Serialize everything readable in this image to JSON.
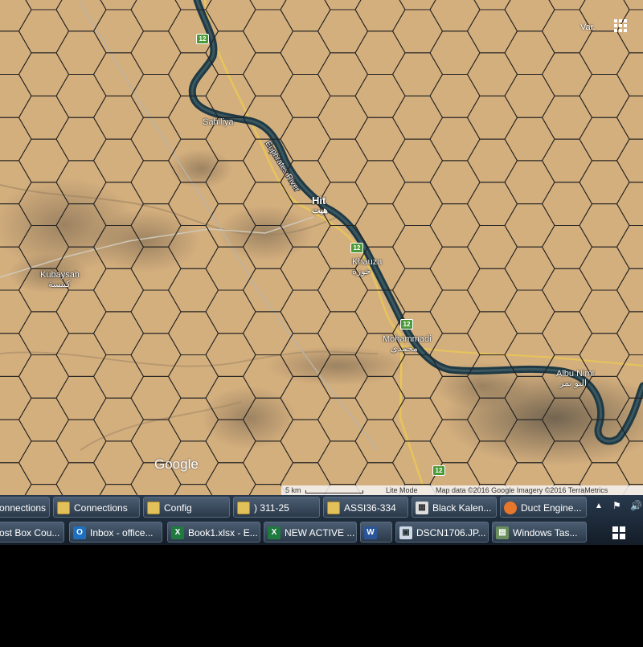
{
  "map": {
    "places": [
      {
        "name": "Sahiliya",
        "arabic": ""
      },
      {
        "name": "Hit",
        "arabic": "هيت"
      },
      {
        "name": "Khauza",
        "arabic": "خوزة"
      },
      {
        "name": "Kubaysah",
        "arabic": "كبيسة"
      },
      {
        "name": "Mohammadi",
        "arabic": "محمدي"
      },
      {
        "name": "Albu Nimr",
        "arabic": "البو نمر"
      }
    ],
    "river_label": "Euphrates River",
    "route_number": "12",
    "google_logo": "Google",
    "top_right_label": "Var.",
    "scale_text": "5 km",
    "view_mode": "Lite Mode",
    "attribution": "Map data ©2016 Google Imagery ©2016 TerraMetrics",
    "hex_overlay": true,
    "colors": {
      "desert": "#d2ad7c",
      "river": "#1f3a44",
      "road": "#e6c45a",
      "hex_line": "#222222"
    }
  },
  "taskbar": {
    "row1": [
      {
        "label": "onnections",
        "icon": "folder-icon"
      },
      {
        "label": "Connections",
        "icon": "folder-icon"
      },
      {
        "label": "Config",
        "icon": "folder-icon"
      },
      {
        "label": ") 311-25",
        "icon": "folder-icon"
      },
      {
        "label": "ASSI36-334",
        "icon": "folder-icon"
      },
      {
        "label": "Black Kalen...",
        "icon": "calendar-icon"
      },
      {
        "label": "Duct Engine...",
        "icon": "firefox-icon"
      }
    ],
    "row2": [
      {
        "label": "ost Box Cou...",
        "icon": ""
      },
      {
        "label": "Inbox - office...",
        "icon": "outlook-icon"
      },
      {
        "label": "Book1.xlsx - E...",
        "icon": "excel-icon"
      },
      {
        "label": "NEW ACTIVE ...",
        "icon": "excel-icon"
      },
      {
        "label": "",
        "icon": "word-icon"
      },
      {
        "label": "DSCN1706.JP...",
        "icon": "image-viewer-icon"
      },
      {
        "label": "Windows Tas...",
        "icon": "task-manager-icon"
      }
    ],
    "tray": {
      "chevron": "▲",
      "flag": "⚑",
      "speaker": "🔊"
    }
  }
}
